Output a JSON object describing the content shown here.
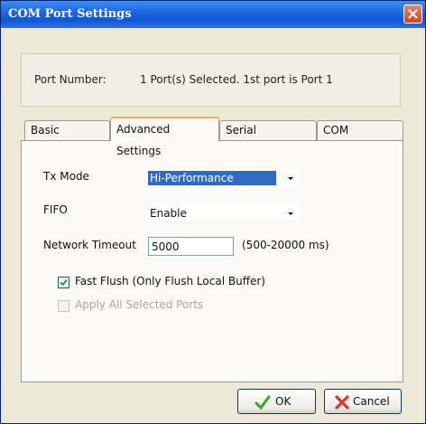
{
  "window": {
    "title": "COM Port Settings"
  },
  "port": {
    "label": "Port Number:",
    "value": "1 Port(s) Selected. 1st port is Port 1"
  },
  "tabs": [
    {
      "label": "Basic Settings"
    },
    {
      "label": "Advanced Settings"
    },
    {
      "label": "Serial Parameters"
    },
    {
      "label": "COM Grouping"
    }
  ],
  "advanced": {
    "tx_mode": {
      "label": "Tx Mode",
      "value": "Hi-Performance"
    },
    "fifo": {
      "label": "FIFO",
      "value": "Enable"
    },
    "network_timeout": {
      "label": "Network Timeout",
      "value": "5000",
      "range": "(500-20000 ms)"
    },
    "fast_flush": {
      "label": "Fast Flush (Only Flush Local Buffer)",
      "checked": true
    },
    "apply_all": {
      "label": "Apply All Selected Ports",
      "checked": false,
      "enabled": false
    }
  },
  "buttons": {
    "ok": "OK",
    "cancel": "Cancel"
  },
  "colors": {
    "titlebar": "#0f56d6",
    "selection": "#316ac5",
    "ok_icon": "#3aa12e",
    "cancel_icon": "#d9362a"
  }
}
